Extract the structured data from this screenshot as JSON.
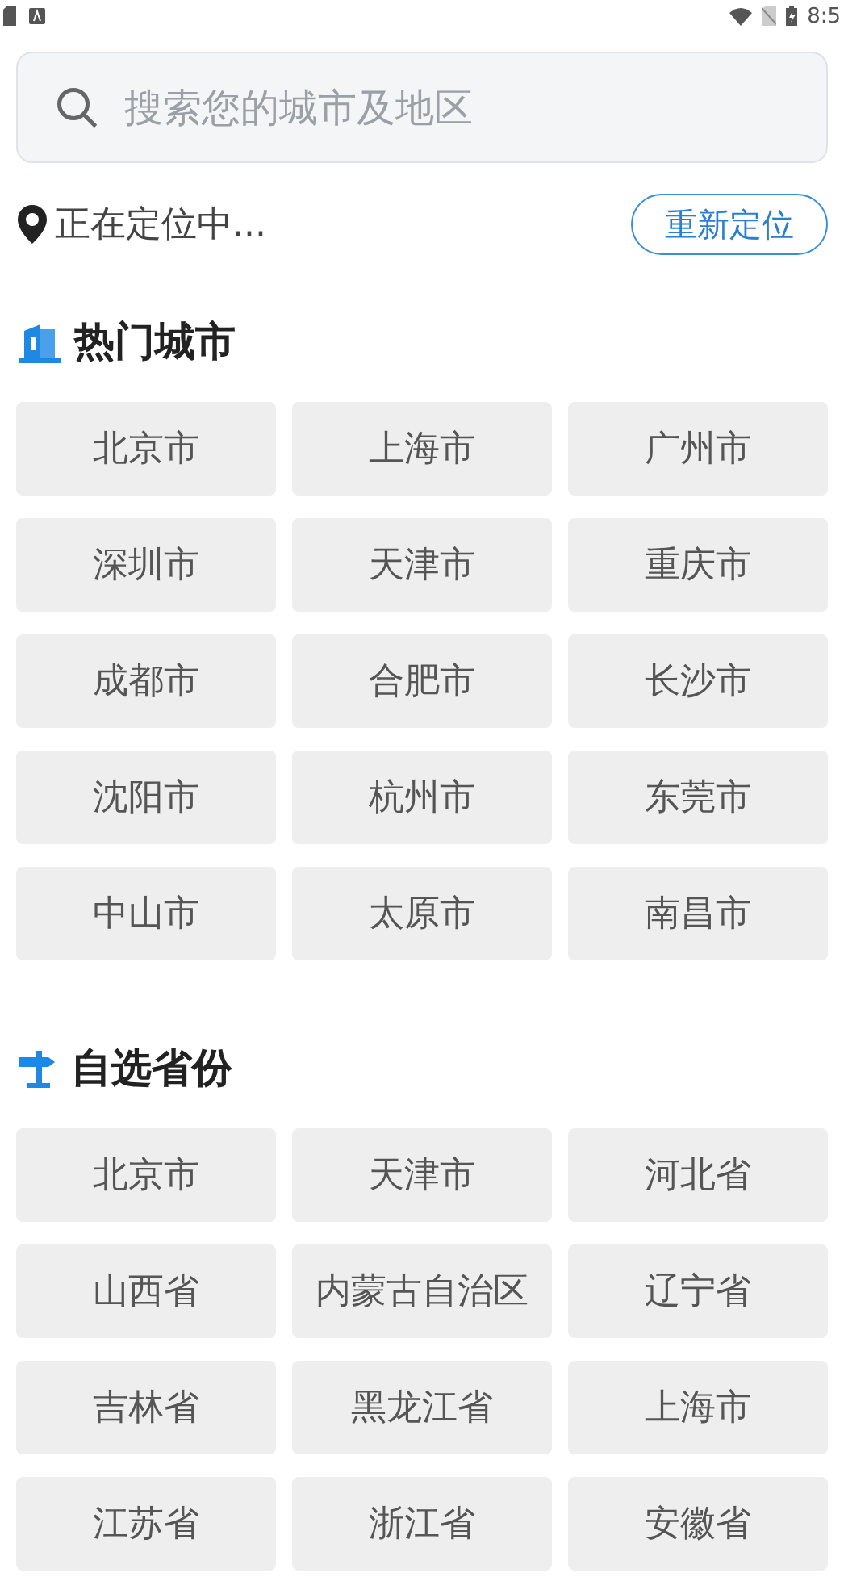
{
  "status_bar": {
    "time": "8:5"
  },
  "search": {
    "placeholder": "搜索您的城市及地区"
  },
  "location": {
    "status": "正在定位中...",
    "button": "重新定位"
  },
  "sections": [
    {
      "kind": "hot",
      "title": "热门城市",
      "items": [
        "北京市",
        "上海市",
        "广州市",
        "深圳市",
        "天津市",
        "重庆市",
        "成都市",
        "合肥市",
        "长沙市",
        "沈阳市",
        "杭州市",
        "东莞市",
        "中山市",
        "太原市",
        "南昌市"
      ]
    },
    {
      "kind": "province",
      "title": "自选省份",
      "items": [
        "北京市",
        "天津市",
        "河北省",
        "山西省",
        "内蒙古自治区",
        "辽宁省",
        "吉林省",
        "黑龙江省",
        "上海市",
        "江苏省",
        "浙江省",
        "安徽省"
      ]
    }
  ]
}
